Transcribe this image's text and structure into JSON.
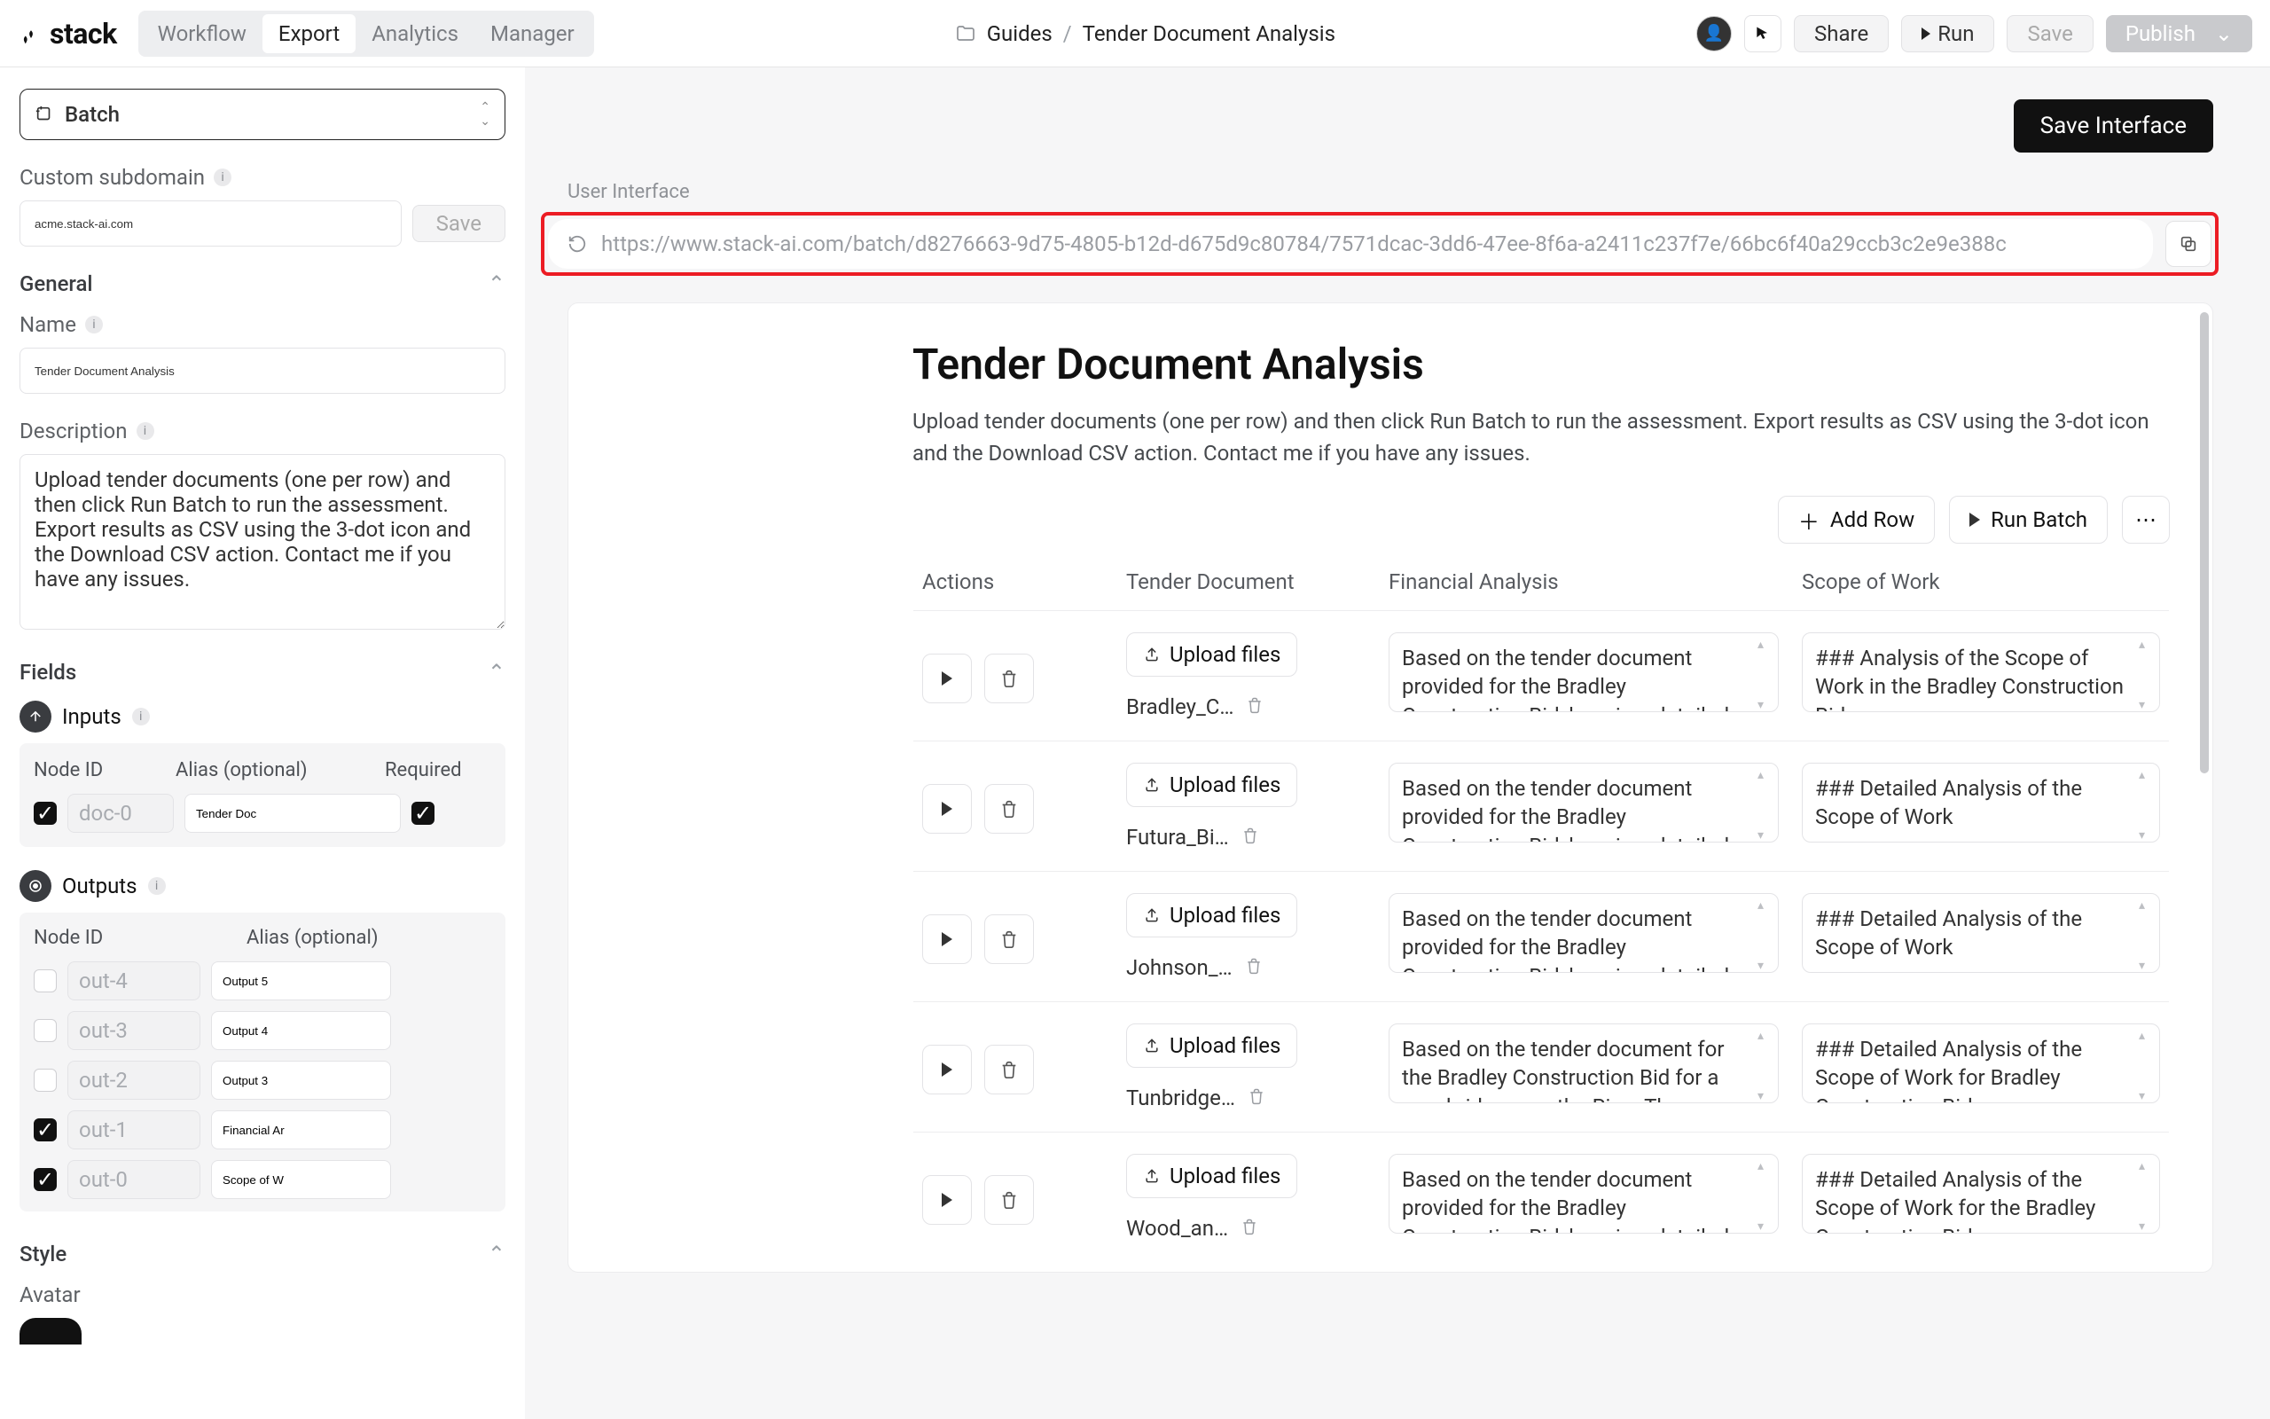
{
  "brand": "stack",
  "nav": {
    "workflow": "Workflow",
    "export": "Export",
    "analytics": "Analytics",
    "manager": "Manager"
  },
  "breadcrumb": {
    "folder": "Guides",
    "page": "Tender Document Analysis"
  },
  "topbar": {
    "share": "Share",
    "run": "Run",
    "save": "Save",
    "publish": "Publish"
  },
  "save_interface": "Save Interface",
  "ui_label": "User Interface",
  "url": "https://www.stack-ai.com/batch/d8276663-9d75-4805-b12d-d675d9c80784/7571dcac-3dd6-47ee-8f6a-a2411c237f7e/66bc6f40a29ccb3c2e9e388c",
  "sidebar": {
    "mode": "Batch",
    "subdomain_label": "Custom subdomain",
    "subdomain_value": "acme.stack-ai.com",
    "save": "Save",
    "general": "General",
    "name_label": "Name",
    "name_value": "Tender Document Analysis",
    "desc_label": "Description",
    "desc_value": "Upload tender documents (one per row) and then click Run Batch to run the assessment. Export results as CSV using the 3-dot icon and the Download CSV action. Contact me if you have any issues.",
    "fields": "Fields",
    "inputs": "Inputs",
    "outputs": "Outputs",
    "hdr_node": "Node ID",
    "hdr_alias": "Alias (optional)",
    "hdr_required": "Required",
    "inputs_rows": [
      {
        "checked": true,
        "node": "doc-0",
        "alias": "Tender Doc",
        "required": true
      }
    ],
    "outputs_rows": [
      {
        "checked": false,
        "node": "out-4",
        "alias": "Output 5"
      },
      {
        "checked": false,
        "node": "out-3",
        "alias": "Output 4"
      },
      {
        "checked": false,
        "node": "out-2",
        "alias": "Output 3"
      },
      {
        "checked": true,
        "node": "out-1",
        "alias": "Financial Ar"
      },
      {
        "checked": true,
        "node": "out-0",
        "alias": "Scope of W"
      }
    ],
    "style": "Style",
    "avatar": "Avatar"
  },
  "preview": {
    "title": "Tender Document Analysis",
    "desc": "Upload tender documents (one per row) and then click Run Batch to run the assessment. Export results as CSV using the 3-dot icon and the Download CSV action. Contact me if you have any issues.",
    "add_row": "Add Row",
    "run_batch": "Run Batch",
    "cols": {
      "actions": "Actions",
      "doc": "Tender Document",
      "fin": "Financial Analysis",
      "scope": "Scope of Work"
    },
    "upload": "Upload files",
    "rows": [
      {
        "file": "Bradley_C…",
        "fin": "Based on the tender document provided for the Bradley Construction Bid, here is a detailed financial",
        "scope": "### Analysis of the Scope of Work in the Bradley Construction Bid"
      },
      {
        "file": "Futura_Bi…",
        "fin": "Based on the tender document provided for the Bradley Construction Bid, here is a detailed financial",
        "scope": "### Detailed Analysis of the Scope of Work"
      },
      {
        "file": "Johnson_…",
        "fin": "Based on the tender document provided for the Bradley Construction Bid, here is a detailed financial",
        "scope": "### Detailed Analysis of the Scope of Work"
      },
      {
        "file": "Tunbridge…",
        "fin": "Based on the tender document for the Bradley Construction Bid for a new bridge over the River Thames",
        "scope": "### Detailed Analysis of the Scope of Work for Bradley Construction Bid"
      },
      {
        "file": "Wood_an…",
        "fin": "Based on the tender document provided for the Bradley Construction Bid, here is a detailed financial",
        "scope": "### Detailed Analysis of the Scope of Work for the Bradley Construction Bid"
      }
    ]
  }
}
